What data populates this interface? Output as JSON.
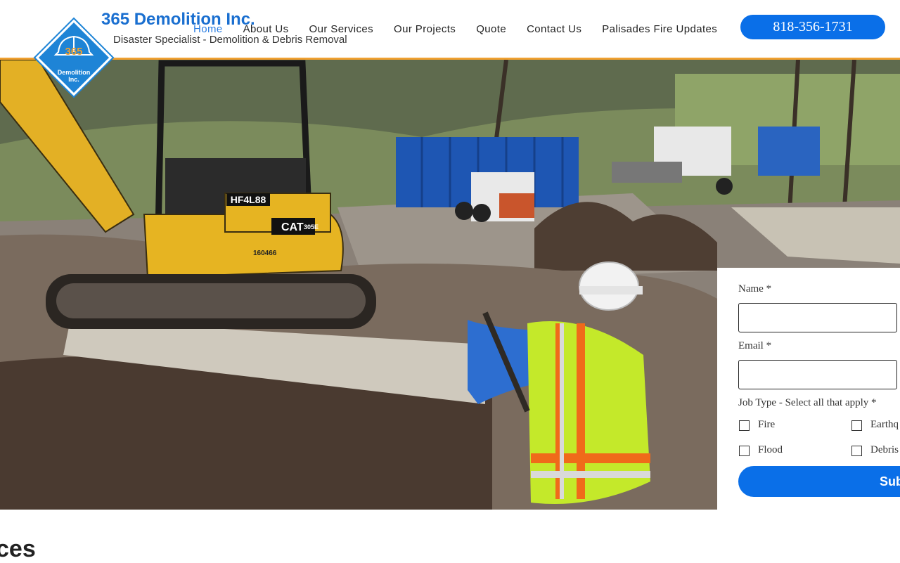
{
  "header": {
    "brand_name": "365 Demolition Inc.",
    "tagline": "Disaster Specialist - Demolition & Debris Removal",
    "logo_text_number": "365",
    "logo_text_line1": "Demolition",
    "logo_text_line2": "Inc.",
    "phone": "818-356-1731"
  },
  "nav": {
    "items": [
      {
        "label": "Home"
      },
      {
        "label": "About Us"
      },
      {
        "label": "Our Services"
      },
      {
        "label": "Our Projects"
      },
      {
        "label": "Quote"
      },
      {
        "label": "Contact Us"
      },
      {
        "label": "Palisades Fire Updates"
      }
    ]
  },
  "hero": {
    "excavator_plate": "HF4L88",
    "excavator_brand": "CAT",
    "excavator_model": "305E",
    "excavator_serial": "160466"
  },
  "form": {
    "name_label": "Name *",
    "name_value": "",
    "email_label": "Email *",
    "email_value": "",
    "job_type_label": "Job Type - Select all that apply *",
    "options": [
      "Fire",
      "Earthq",
      "Flood",
      "Debris"
    ],
    "submit_label": "Sub"
  },
  "section": {
    "title_fragment": "ces"
  },
  "colors": {
    "accent": "#0a6fe8",
    "brand": "#1a6fd0",
    "header_border": "#f0a030"
  }
}
